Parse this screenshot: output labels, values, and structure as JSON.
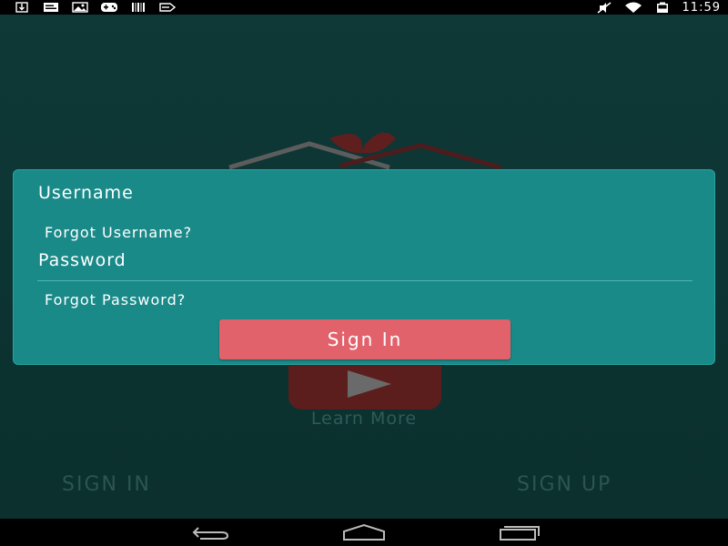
{
  "status_bar": {
    "time": "11:59",
    "left_icons": [
      "download-icon",
      "message-icon",
      "image-icon",
      "game-icon",
      "barcode-icon",
      "bookmark-icon"
    ],
    "right_icons": [
      "mute-icon",
      "wifi-icon",
      "battery-icon"
    ]
  },
  "background": {
    "learn_more": "Learn More",
    "tabs": {
      "sign_in": "SIGN IN",
      "sign_up": "SIGN UP"
    }
  },
  "login": {
    "username_label": "Username",
    "username_value": "",
    "forgot_username": "Forgot Username?",
    "password_label": "Password",
    "password_value": "",
    "forgot_password": "Forgot Password?",
    "sign_in_button": "Sign In"
  },
  "colors": {
    "card": "#1a8a89",
    "button": "#e2626b",
    "background": "#0d3432"
  }
}
